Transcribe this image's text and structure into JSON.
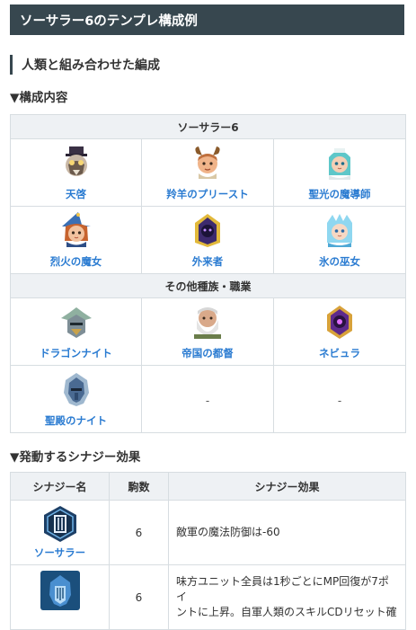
{
  "header": {
    "title": "ソーサラー6のテンプレ構成例"
  },
  "subheading": "人類と組み合わせた編成",
  "composition": {
    "heading": "▼構成内容",
    "group1_title": "ソーサラー6",
    "group1_units": [
      {
        "name": "天啓",
        "icon": "celestial-avatar-icon"
      },
      {
        "name": "羚羊のプリースト",
        "icon": "antelope-priest-avatar-icon"
      },
      {
        "name": "聖光の魔導師",
        "icon": "holy-light-mage-avatar-icon"
      },
      {
        "name": "烈火の魔女",
        "icon": "blaze-witch-avatar-icon"
      },
      {
        "name": "外来者",
        "icon": "outsider-avatar-icon"
      },
      {
        "name": "氷の巫女",
        "icon": "ice-maiden-avatar-icon"
      }
    ],
    "group2_title": "その他種族・職業",
    "group2_units": [
      {
        "name": "ドラゴンナイト",
        "icon": "dragon-knight-avatar-icon"
      },
      {
        "name": "帝国の都督",
        "icon": "imperial-governor-avatar-icon"
      },
      {
        "name": "ネビュラ",
        "icon": "nebula-avatar-icon"
      },
      {
        "name": "聖殿のナイト",
        "icon": "temple-knight-avatar-icon"
      },
      {
        "name": "-"
      },
      {
        "name": "-"
      }
    ]
  },
  "synergy": {
    "heading": "▼発動するシナジー効果",
    "columns": [
      "シナジー名",
      "駒数",
      "シナジー効果"
    ],
    "rows": [
      {
        "name": "ソーサラー",
        "count": "6",
        "effect": "敵軍の魔法防御は-60",
        "icon": "sorcerer-synergy-icon"
      },
      {
        "name": "",
        "count": "6",
        "effect_line1": "味方ユニット全員は1秒ごとにMP回復が7ポイ",
        "effect_line2": "ントに上昇。自軍人類のスキルCDリセット確",
        "icon": "human-synergy-icon"
      }
    ]
  },
  "colors": {
    "header_bg": "#37474f",
    "link": "#2a7bd1",
    "band_bg": "#eef1f4",
    "border": "#d7dde1"
  }
}
